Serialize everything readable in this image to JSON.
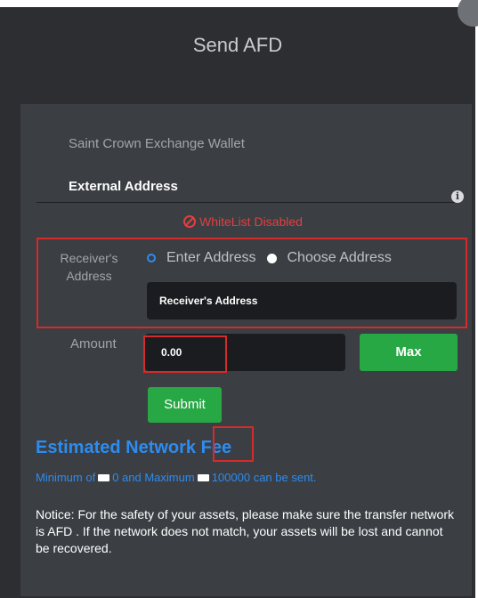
{
  "modal": {
    "title": "Send AFD"
  },
  "tabs": {
    "wallet": "Saint Crown Exchange Wallet",
    "external": "External Address"
  },
  "whitelist": {
    "status": "WhiteList Disabled"
  },
  "receiver": {
    "label": "Receiver's Address",
    "options": [
      "Enter Address",
      "Choose Address"
    ],
    "selected": "Enter Address",
    "placeholder": "Receiver's Address"
  },
  "amount": {
    "label": "Amount",
    "value": "0.00",
    "max_label": "Max"
  },
  "submit_label": "Submit",
  "fee": {
    "title_prefix": "Estimated Network ",
    "title_highlight": "Fee",
    "limits_prefix": "Minimum of",
    "min": "0",
    "limits_mid": "and Maximum",
    "max": "100000",
    "limits_suffix": "can be sent."
  },
  "notice": "Notice: For the safety of your assets, please make sure the transfer network is AFD . If the network does not match, your assets will be lost and cannot be recovered.",
  "colors": {
    "accent_blue": "#2d8cf0",
    "button_green": "#28a745",
    "alert_red": "#e0403f",
    "highlight_red": "#d42b2b"
  }
}
